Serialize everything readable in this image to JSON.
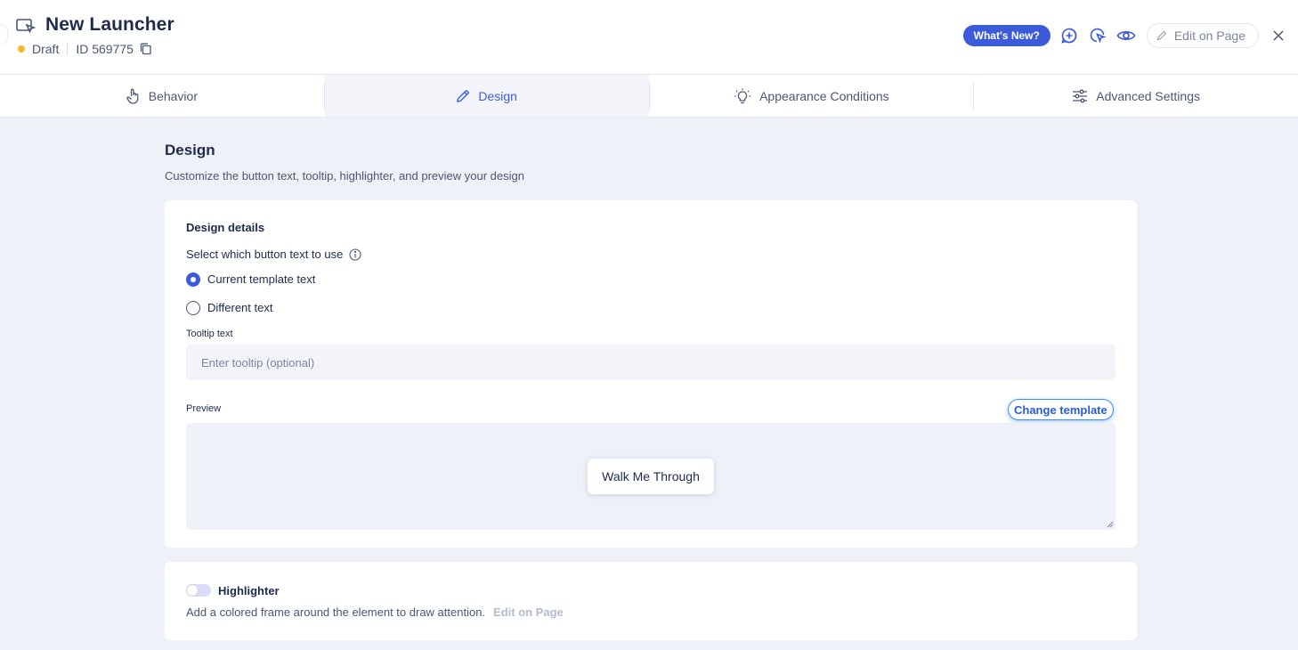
{
  "header": {
    "title": "New Launcher",
    "status": "Draft",
    "id_label": "ID 569775",
    "whats_new": "What's New?",
    "edit_on_page": "Edit on Page",
    "status_color": "#f5b92e",
    "accent_color": "#3b5bdb"
  },
  "tabs": [
    {
      "label": "Behavior",
      "icon": "hand-pointer-icon"
    },
    {
      "label": "Design",
      "icon": "pencil-icon",
      "active": true
    },
    {
      "label": "Appearance Conditions",
      "icon": "lightbulb-icon"
    },
    {
      "label": "Advanced Settings",
      "icon": "sliders-icon"
    }
  ],
  "section": {
    "title": "Design",
    "subtitle": "Customize the button text, tooltip, highlighter, and preview your design"
  },
  "design_details": {
    "title": "Design details",
    "button_text_question": "Select which button text to use",
    "options": [
      {
        "label": "Current template text",
        "checked": true
      },
      {
        "label": "Different text",
        "checked": false
      }
    ],
    "tooltip_label": "Tooltip text",
    "tooltip_placeholder": "Enter tooltip (optional)",
    "preview_label": "Preview",
    "change_template": "Change template",
    "preview_button": "Walk Me Through"
  },
  "highlighter": {
    "label": "Highlighter",
    "enabled": false,
    "description": "Add a colored frame around the element to draw attention.",
    "edit_link": "Edit on Page"
  }
}
